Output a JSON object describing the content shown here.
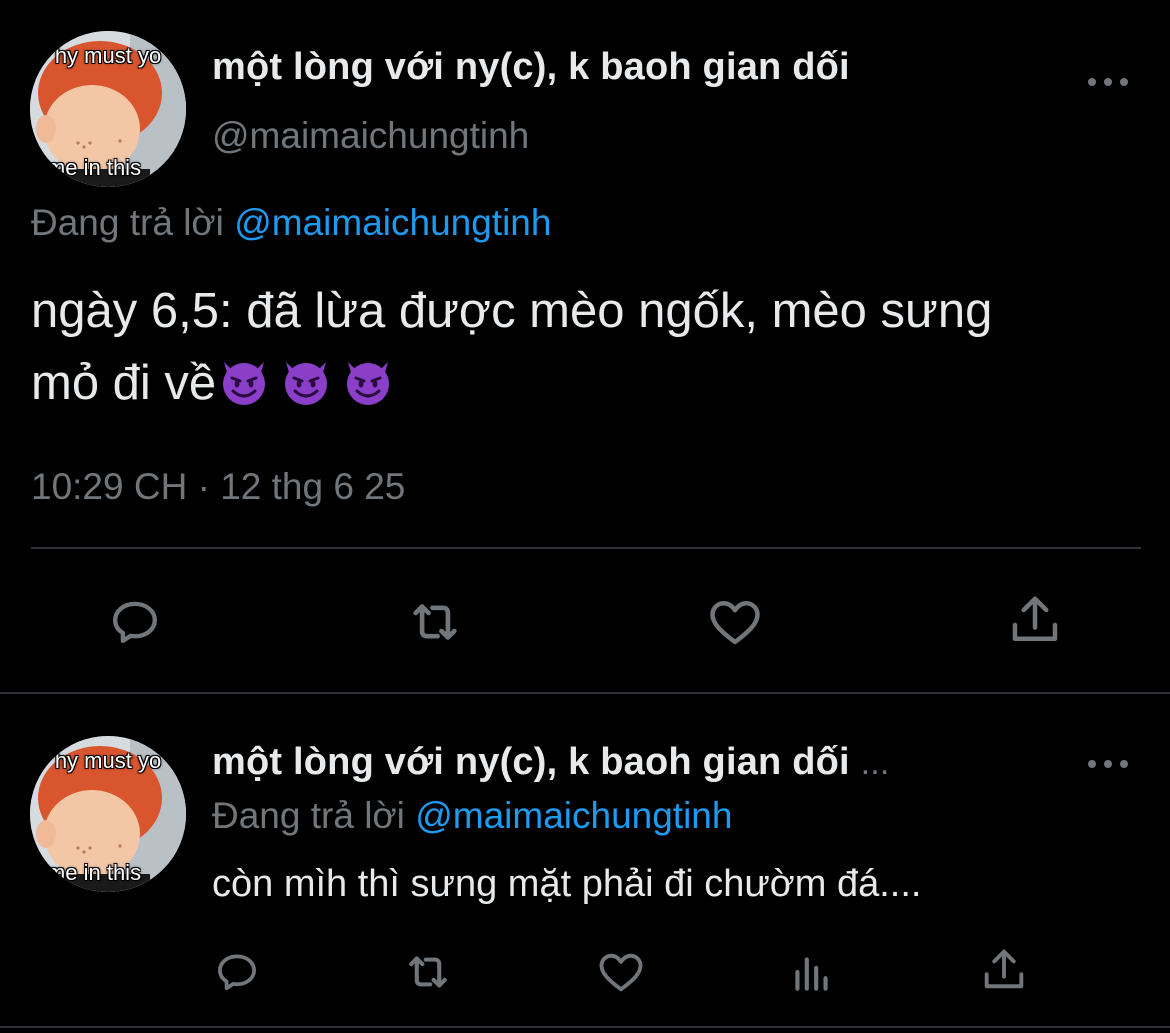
{
  "main_tweet": {
    "avatar": {
      "caption_top": "hy must yo",
      "caption_bottom": "me in this"
    },
    "display_name": "một lòng với ny(c), k baoh gian dối",
    "handle": "@maimaichungtinh",
    "replying_prefix": "Đang trả lời",
    "replying_to": "@maimaichungtinh",
    "text_line1": "ngày 6,5: đã lừa được mèo ngốk, mèo sưng",
    "text_line2": "mỏ đi về",
    "emojis": [
      "smiling-imp-emoji",
      "smiling-imp-emoji",
      "smiling-imp-emoji"
    ],
    "timestamp": "10:29 CH · 12 thg 6 25",
    "actions": [
      "reply-icon",
      "retweet-icon",
      "like-icon",
      "share-icon"
    ]
  },
  "reply_tweet": {
    "avatar": {
      "caption_top": "hy must yo",
      "caption_bottom": "me in this"
    },
    "display_name": "một lòng với ny(c), k baoh gian dối",
    "name_ellipsis": "...",
    "replying_prefix": "Đang trả lời",
    "replying_to": "@maimaichungtinh",
    "text": "còn mìh thì sưng mặt phải đi chườm đá....",
    "actions": [
      "reply-icon",
      "retweet-icon",
      "like-icon",
      "views-icon",
      "share-icon"
    ]
  },
  "colors": {
    "background": "#000000",
    "text": "#e7e9ea",
    "secondary": "#71767b",
    "link": "#1d9bf0",
    "divider": "#2f3336",
    "emoji_purple": "#8b3fc9"
  }
}
